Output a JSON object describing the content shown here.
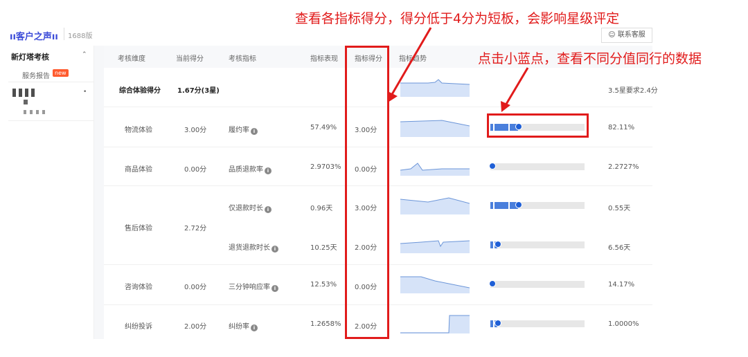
{
  "header": {
    "logo": "ıı客户之声ıı",
    "edition": "1688版",
    "contact_button": "联系客服"
  },
  "sidebar": {
    "section_title": "新灯塔考核",
    "item": "服务报告",
    "badge": "new"
  },
  "table": {
    "columns": [
      "考核维度",
      "当前得分",
      "考核指标",
      "指标表现",
      "指标得分",
      "指标趋势"
    ],
    "summary": {
      "label": "综合体验得分",
      "score": "1.67分(3星)",
      "note": "3.5星要求2.4分"
    },
    "rows": [
      {
        "dimension": "物流体验",
        "current": "3.00分",
        "metric": "履约率",
        "value": "57.49%",
        "score": "3.00分",
        "peer": "82.11%",
        "bar_fill": 0.3
      },
      {
        "dimension": "商品体验",
        "current": "0.00分",
        "metric": "品质退款率",
        "value": "2.9703%",
        "score": "0.00分",
        "peer": "2.2727%",
        "bar_fill": 0.02
      },
      {
        "dimension": "售后体验",
        "current": "2.72分",
        "metric": "仅退款时长",
        "value": "0.96天",
        "score": "3.00分",
        "peer": "0.55天",
        "bar_fill": 0.3
      },
      {
        "dimension": "",
        "current": "",
        "metric": "退货退款时长",
        "value": "10.25天",
        "score": "2.00分",
        "peer": "6.56天",
        "bar_fill": 0.08
      },
      {
        "dimension": "咨询体验",
        "current": "0.00分",
        "metric": "三分钟响应率",
        "value": "12.53%",
        "score": "0.00分",
        "peer": "14.17%",
        "bar_fill": 0.02
      },
      {
        "dimension": "纠纷投诉",
        "current": "2.00分",
        "metric": "纠纷率",
        "value": "1.2658%",
        "score": "2.00分",
        "peer": "1.0000%",
        "bar_fill": 0.08
      }
    ]
  },
  "annotations": {
    "top": "查看各指标得分，得分低于4分为短板，会影响星级评定",
    "right": "点击小蓝点，查看不同分值同行的数据"
  },
  "colors": {
    "annotation": "#e11b1b",
    "bar_fill": "#4a7fdc",
    "dot": "#1f5fd6",
    "spark_fill": "#d6e3f8",
    "spark_line": "#6b95d8",
    "logo": "#3b4bd8",
    "badge": "#ff5b2e"
  },
  "icons": {
    "info": "info-circle-icon",
    "contact": "headset-icon",
    "collapse": "chevron-up-icon"
  }
}
